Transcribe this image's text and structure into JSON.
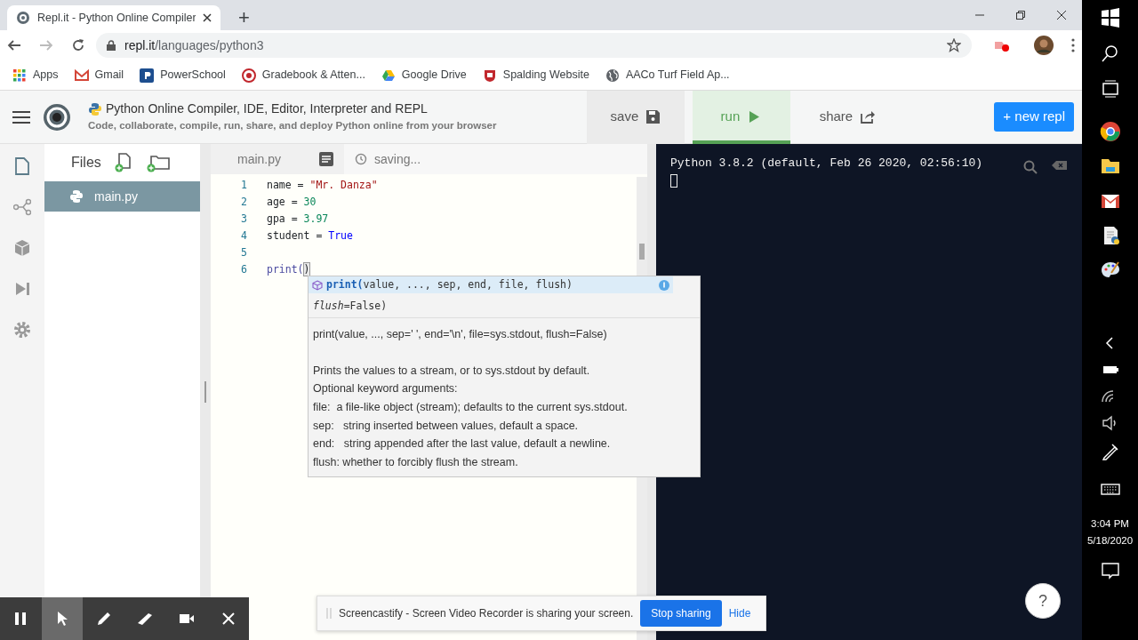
{
  "browser": {
    "tab": {
      "title": "Repl.it - Python Online Compiler"
    },
    "new_tab": "+",
    "address": {
      "host": "repl.it",
      "path": "/languages/python3"
    },
    "bookmarks": [
      {
        "label": "Apps",
        "kind": "apps"
      },
      {
        "label": "Gmail",
        "kind": "gmail"
      },
      {
        "label": "PowerSchool",
        "kind": "powerschool"
      },
      {
        "label": "Gradebook & Atten...",
        "kind": "gradebook"
      },
      {
        "label": "Google Drive",
        "kind": "drive"
      },
      {
        "label": "Spalding Website",
        "kind": "spalding"
      },
      {
        "label": "AACo Turf Field Ap...",
        "kind": "globe"
      }
    ]
  },
  "app_header": {
    "title": "Python Online Compiler, IDE, Editor, Interpreter and REPL",
    "subtitle": "Code, collaborate, compile, run, share, and deploy Python online from your browser",
    "actions": [
      {
        "label": "save",
        "kind": "save",
        "selected": false
      },
      {
        "label": "run",
        "kind": "run",
        "selected": true
      },
      {
        "label": "share",
        "kind": "share",
        "selected": false
      }
    ],
    "new_repl": "+ new repl"
  },
  "files_panel": {
    "title": "Files",
    "files": [
      {
        "name": "main.py",
        "selected": true
      }
    ]
  },
  "editor": {
    "tab": "main.py",
    "status": "saving...",
    "lines": [
      {
        "number": "1",
        "tokens": [
          {
            "text": "name = ",
            "kind": "plain"
          },
          {
            "text": "\"Mr. Danza\"",
            "kind": "string"
          }
        ]
      },
      {
        "number": "2",
        "tokens": [
          {
            "text": "age = ",
            "kind": "plain"
          },
          {
            "text": "30",
            "kind": "number"
          }
        ]
      },
      {
        "number": "3",
        "tokens": [
          {
            "text": "gpa = ",
            "kind": "plain"
          },
          {
            "text": "3.97",
            "kind": "number"
          }
        ]
      },
      {
        "number": "4",
        "tokens": [
          {
            "text": "student = ",
            "kind": "plain"
          },
          {
            "text": "True",
            "kind": "keyword"
          }
        ]
      },
      {
        "number": "5"
      },
      {
        "number": "6",
        "tokens": [
          {
            "text": "print(",
            "kind": "builtin"
          },
          {
            "text": ")",
            "kind": "bracket"
          }
        ]
      }
    ]
  },
  "autocomplete": {
    "suggestion_name": "print(",
    "suggestion_params": "value, ..., sep, end, file, flush)",
    "signature_tail": "*flush*=False)",
    "signature": "print(value, ..., sep=' ', end='\\n', file=sys.stdout, flush=False)",
    "doc_lines": [
      "Prints the values to a stream, or to sys.stdout by default.",
      "Optional keyword arguments:",
      "file:  a file-like object (stream); defaults to the current sys.stdout.",
      "sep:   string inserted between values, default a space.",
      "end:   string appended after the last value, default a newline.",
      "flush: whether to forcibly flush the stream."
    ]
  },
  "console": {
    "banner": "Python 3.8.2 (default, Feb 26 2020, 02:56:10)"
  },
  "recorder_toolbar": {
    "tools": [
      {
        "kind": "pause",
        "selected": false
      },
      {
        "kind": "pointer",
        "selected": true
      },
      {
        "kind": "pen",
        "selected": false
      },
      {
        "kind": "eraser",
        "selected": false
      },
      {
        "kind": "camera",
        "selected": false
      },
      {
        "kind": "close",
        "selected": false
      }
    ]
  },
  "sharing_bar": {
    "message": "Screencastify - Screen Video Recorder is sharing your screen.",
    "stop": "Stop sharing",
    "hide": "Hide"
  },
  "help": "?",
  "taskbar": {
    "time": "3:04 PM",
    "date": "5/18/2020"
  }
}
